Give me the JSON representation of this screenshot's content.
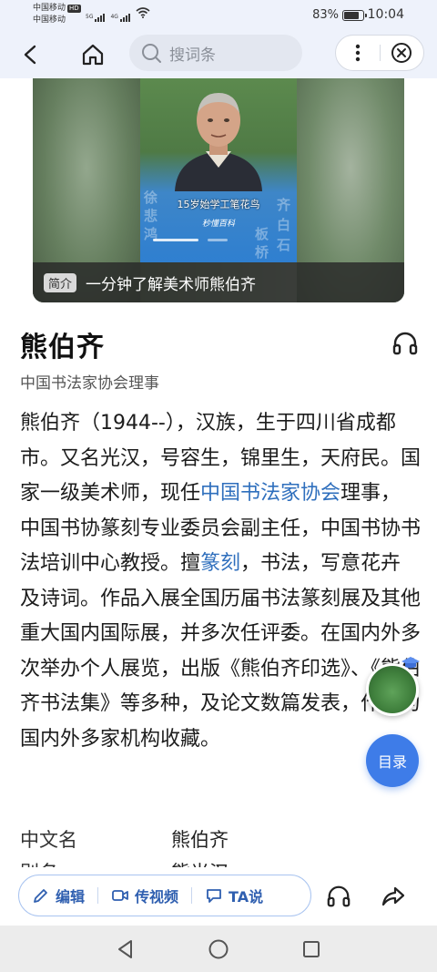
{
  "status_bar": {
    "carrier_1": "中国移动",
    "carrier_1_badge": "HD",
    "carrier_2": "中国移动",
    "signal_1_label": "5G",
    "signal_2_label": "4G",
    "battery_percent": "83%",
    "battery_level": 0.83,
    "time": "10:04"
  },
  "nav": {
    "search_placeholder": "搜词条",
    "icons": [
      "back-arrow-icon",
      "home-icon",
      "search-icon",
      "more-vertical-icon",
      "close-circle-icon"
    ]
  },
  "video": {
    "overlay_subtitle": "15岁始学工笔花鸟",
    "overlay_logo": "秒懂百科",
    "caption_badge": "简介",
    "caption_text": "一分钟了解美术师熊伯齐"
  },
  "entry": {
    "title": "熊伯齐",
    "subtitle": "中国书法家协会理事",
    "bio_parts": [
      {
        "text": "熊伯齐（1944--），汉族，生于四川省成都市。又名光汉，号容生，锦里生，天府民。国家一级美术师，现任",
        "link": false
      },
      {
        "text": "中国书法家协会",
        "link": true
      },
      {
        "text": "理事，中国书协篆刻专业委员会副主任，中国书协书法培训中心教授。擅",
        "link": false
      },
      {
        "text": "篆刻",
        "link": true
      },
      {
        "text": "，书法，写意花卉及诗词。作品入展全国历届书法篆刻展及其他重大国内国际展，并多次任评委。在国内外多次举办个人展览，出版《熊伯齐印选》、《熊伯齐书法集》等多种，及论文数篇发表，作品为国内外多家机构收藏。",
        "link": false
      }
    ],
    "info": [
      {
        "key": "中文名",
        "value": "熊伯齐"
      },
      {
        "key": "别名",
        "value": "熊光汉"
      }
    ]
  },
  "floating": {
    "toc_label": "目录"
  },
  "bottom_bar": {
    "edit_label": "编辑",
    "video_label": "传视频",
    "ta_label": "TA说"
  },
  "colors": {
    "accent": "#3e7ce8",
    "link": "#2f6fbd",
    "header_bg": "#eef2fb"
  }
}
